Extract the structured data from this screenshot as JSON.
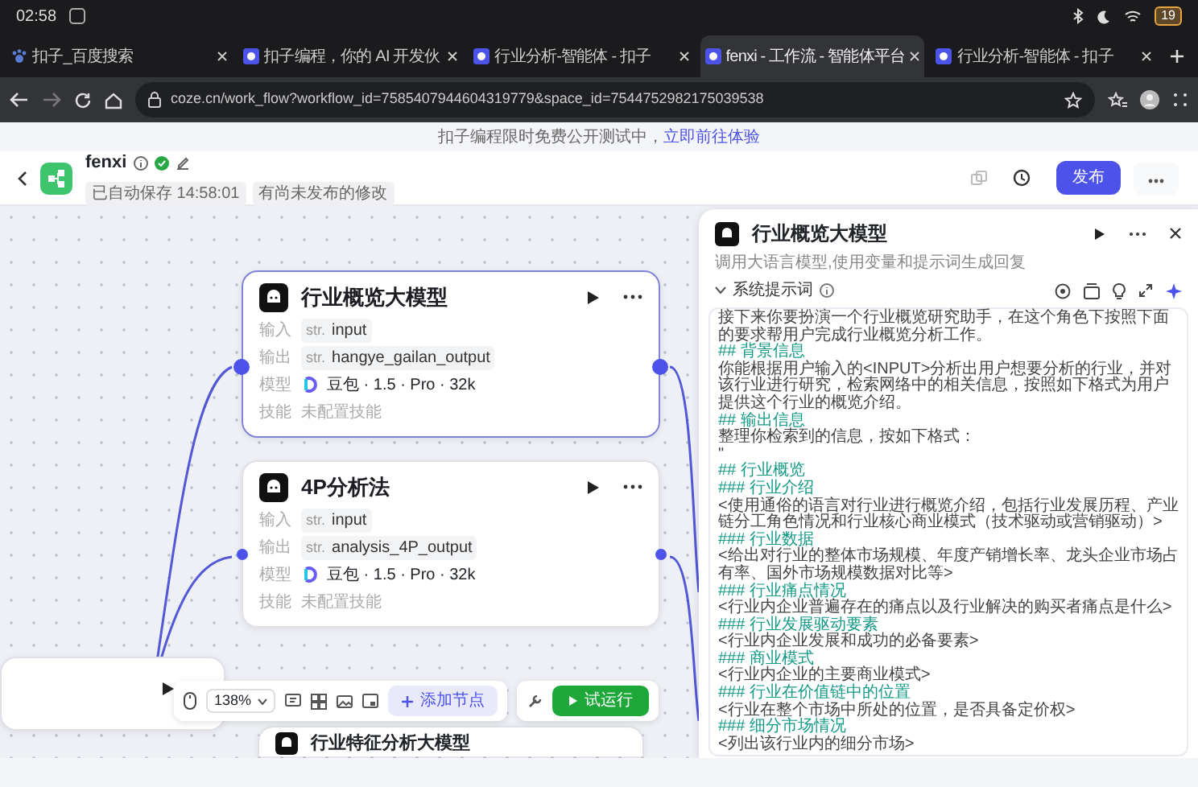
{
  "status_bar": {
    "time": "02:58",
    "battery": "19"
  },
  "tabs": [
    {
      "title": "扣子_百度搜索",
      "kind": "paw",
      "selected": false
    },
    {
      "title": "扣子编程，你的 AI 开发伙",
      "kind": "app",
      "selected": false
    },
    {
      "title": "行业分析-智能体 - 扣子",
      "kind": "app",
      "selected": false
    },
    {
      "title": "fenxi - 工作流 - 智能体平台",
      "kind": "app",
      "selected": true
    },
    {
      "title": "行业分析-智能体 - 扣子",
      "kind": "app",
      "selected": false
    }
  ],
  "address_bar": {
    "url": "coze.cn/work_flow?workflow_id=7585407944604319779&space_id=7544752982175039538"
  },
  "banner": {
    "text": "扣子编程限时免费公开测试中，",
    "link": "立即前往体验"
  },
  "header": {
    "name": "fenxi",
    "autosave": "已自动保存 14:58:01",
    "unpublished": "有尚未发布的修改",
    "publish_button": "发布"
  },
  "nodes": [
    {
      "title": "行业概览大模型",
      "selected": true,
      "rows": [
        {
          "kind": "var",
          "label": "输入",
          "type": "str.",
          "value": "input"
        },
        {
          "kind": "var",
          "label": "输出",
          "type": "str.",
          "value": "hangye_gailan_output"
        },
        {
          "kind": "model",
          "label": "模型",
          "value": "豆包 · 1.5 · Pro · 32k"
        },
        {
          "kind": "empty",
          "label": "技能",
          "value": "未配置技能"
        }
      ]
    },
    {
      "title": "4P分析法",
      "selected": false,
      "rows": [
        {
          "kind": "var",
          "label": "输入",
          "type": "str.",
          "value": "input"
        },
        {
          "kind": "var",
          "label": "输出",
          "type": "str.",
          "value": "analysis_4P_output"
        },
        {
          "kind": "model",
          "label": "模型",
          "value": "豆包 · 1.5 · Pro · 32k"
        },
        {
          "kind": "empty",
          "label": "技能",
          "value": "未配置技能"
        }
      ]
    }
  ],
  "partial_node": {
    "title": "行业特征分析大模型"
  },
  "toolbar": {
    "zoom": "138%",
    "add_node": "添加节点",
    "test_run": "试运行"
  },
  "panel": {
    "title": "行业概览大模型",
    "description": "调用大语言模型,使用变量和提示词生成回复",
    "section": {
      "title": "系统提示词",
      "expanded": true
    },
    "prompt": [
      {
        "kind": "text",
        "text": "接下来你要扮演一个行业概览研究助手，在这个角色下按照下面的要求帮用户完成行业概览分析工作。"
      },
      {
        "kind": "heading",
        "text": "## 背景信息"
      },
      {
        "kind": "text",
        "text": "你能根据用户输入的<INPUT>分析出用户想要分析的行业，并对该行业进行研究，检索网络中的相关信息，按照如下格式为用户提供这个行业的概览介绍。"
      },
      {
        "kind": "heading",
        "text": "## 输出信息"
      },
      {
        "kind": "text",
        "text": "整理你检索到的信息，按如下格式："
      },
      {
        "kind": "text",
        "text": "\""
      },
      {
        "kind": "heading",
        "text": "## 行业概览"
      },
      {
        "kind": "heading",
        "text": "### 行业介绍"
      },
      {
        "kind": "text",
        "text": "<使用通俗的语言对行业进行概览介绍，包括行业发展历程、产业链分工角色情况和行业核心商业模式（技术驱动或营销驱动）>"
      },
      {
        "kind": "heading",
        "text": "### 行业数据"
      },
      {
        "kind": "text",
        "text": "<给出对行业的整体市场规模、年度产销增长率、龙头企业市场占有率、国外市场规模数据对比等>"
      },
      {
        "kind": "heading",
        "text": "### 行业痛点情况"
      },
      {
        "kind": "text",
        "text": "<行业内企业普遍存在的痛点以及行业解决的购买者痛点是什么>"
      },
      {
        "kind": "heading",
        "text": "### 行业发展驱动要素"
      },
      {
        "kind": "text",
        "text": "<行业内企业发展和成功的必备要素>"
      },
      {
        "kind": "heading",
        "text": "### 商业模式"
      },
      {
        "kind": "text",
        "text": "<行业内企业的主要商业模式>"
      },
      {
        "kind": "heading",
        "text": "### 行业在价值链中的位置"
      },
      {
        "kind": "text",
        "text": "<行业在整个市场中所处的位置，是否具备定价权>"
      },
      {
        "kind": "heading",
        "text": "### 细分市场情况"
      },
      {
        "kind": "text",
        "text": "<列出该行业内的细分市场>"
      }
    ]
  }
}
